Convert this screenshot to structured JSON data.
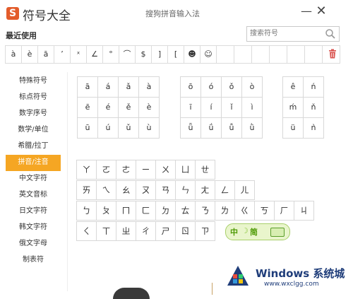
{
  "title": "符号大全",
  "ime_name": "搜狗拼音输入法",
  "controls": {
    "minimize": "—",
    "close": "✕"
  },
  "recent": {
    "label": "最近使用",
    "items": [
      "à",
      "è",
      "ā",
      "’",
      "ˣ",
      "∠",
      "°",
      "⌒",
      "$",
      "]",
      "[",
      "☻",
      "☺",
      "",
      "",
      "",
      "",
      "",
      "",
      ""
    ]
  },
  "search": {
    "placeholder": "搜索符号"
  },
  "sidebar": {
    "items": [
      "特殊符号",
      "标点符号",
      "数字序号",
      "数学/单位",
      "希腊/拉丁",
      "拼音/注音",
      "中文字符",
      "英文音标",
      "日文字符",
      "韩文字符",
      "俄文字母",
      "制表符"
    ],
    "active_index": 5
  },
  "pinyin": {
    "group_a": [
      "ā",
      "á",
      "ǎ",
      "à",
      "ē",
      "é",
      "ě",
      "è",
      "ū",
      "ú",
      "ǔ",
      "ù"
    ],
    "group_o": [
      "ō",
      "ó",
      "ǒ",
      "ò",
      "ī",
      "í",
      "ǐ",
      "ì",
      "ǖ",
      "ǘ",
      "ǚ",
      "ǜ"
    ],
    "group_e": [
      "ê",
      "ń",
      "ḿ",
      "ň",
      "ü",
      "ǹ"
    ]
  },
  "zhuyin": {
    "row1": [
      "ㄚ",
      "ㄛ",
      "ㄜ",
      "ㄧ",
      "ㄨ",
      "ㄩ",
      "ㄝ"
    ],
    "row2": [
      "ㄞ",
      "ㄟ",
      "ㄠ",
      "ㄡ",
      "ㄢ",
      "ㄣ",
      "ㄤ",
      "ㄥ",
      "ㄦ"
    ],
    "row3": [
      "ㄅ",
      "ㄆ",
      "ㄇ",
      "ㄈ",
      "ㄉ",
      "ㄊ",
      "ㄋ",
      "ㄌ",
      "ㄍ",
      "ㄎ",
      "ㄏ",
      "ㄐ"
    ],
    "row4": [
      "ㄑ",
      "ㄒ",
      "ㄓ",
      "ㄔ",
      "ㄕ",
      "ㄖ",
      "ㄗ"
    ]
  },
  "ime_bar": {
    "lang": "中",
    "mode": "简"
  },
  "watermark": {
    "title": "Windows 系统城",
    "url": "www.wxclgg.com"
  },
  "colors": {
    "active_tab": "#f5a623",
    "logo": "#e35c2b",
    "trash": "#d9534f"
  }
}
